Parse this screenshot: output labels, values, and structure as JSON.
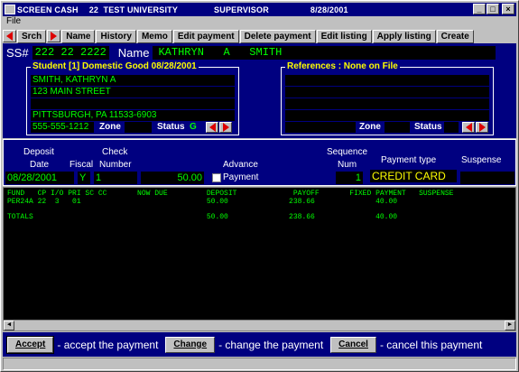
{
  "title": {
    "app": "SCREEN CASH",
    "institution": "22  TEST UNIVERSITY",
    "role": "SUPERVISOR",
    "date": "8/28/2001"
  },
  "menu": {
    "file": "File"
  },
  "toolbar": {
    "search": "Srch",
    "name": "Name",
    "history": "History",
    "memo": "Memo",
    "edit_payment": "Edit payment",
    "delete_payment": "Delete payment",
    "edit_listing": "Edit listing",
    "apply_listing": "Apply listing",
    "create": "Create"
  },
  "header": {
    "ss_label": "SS#",
    "ss_value": "222 22 2222",
    "name_label": "Name",
    "name_value": "KATHRYN   A   SMITH"
  },
  "student": {
    "title": "Student    [1] Domestic Good  08/28/2001",
    "address": [
      "SMITH, KATHRYN A",
      "123 MAIN STREET",
      "",
      "PITTSBURGH, PA 11533-6903"
    ],
    "phone": "555-555-1212",
    "zone_label": "Zone",
    "zone_value": "",
    "status_label": "Status",
    "status_value": "G"
  },
  "references": {
    "title": "References :  None on File",
    "lines": [
      "",
      "",
      "",
      ""
    ],
    "zone_label": "Zone",
    "status_label": "Status"
  },
  "payment": {
    "headers": {
      "deposit": "Deposit",
      "date": "Date",
      "fiscal": "Fiscal",
      "check": "Check",
      "number": "Number",
      "advance": "Advance",
      "sequence": "Sequence",
      "num": "Num",
      "payment_type": "Payment type",
      "suspense": "Suspense",
      "payment_chk": "Payment"
    },
    "date": "08/28/2001",
    "fiscal": "Y",
    "check_number": "1",
    "amount": "50.00",
    "sequence_num": "1",
    "payment_type": "CREDIT CARD",
    "suspense": ""
  },
  "grid": {
    "header": "FUND   CP I/O PRI SC CC       NOW DUE         DEPOSIT             PAYOFF       FIXED PAYMENT   SUSPENSE",
    "row1": "PER24A 22  3   01                             50.00              238.66              40.00",
    "row2": "TOTALS                                        50.00              238.66              40.00"
  },
  "actions": {
    "accept": "Accept",
    "accept_text": "- accept the payment",
    "change": "Change",
    "change_text": "- change the payment",
    "cancel": "Cancel",
    "cancel_text": "- cancel this payment"
  }
}
